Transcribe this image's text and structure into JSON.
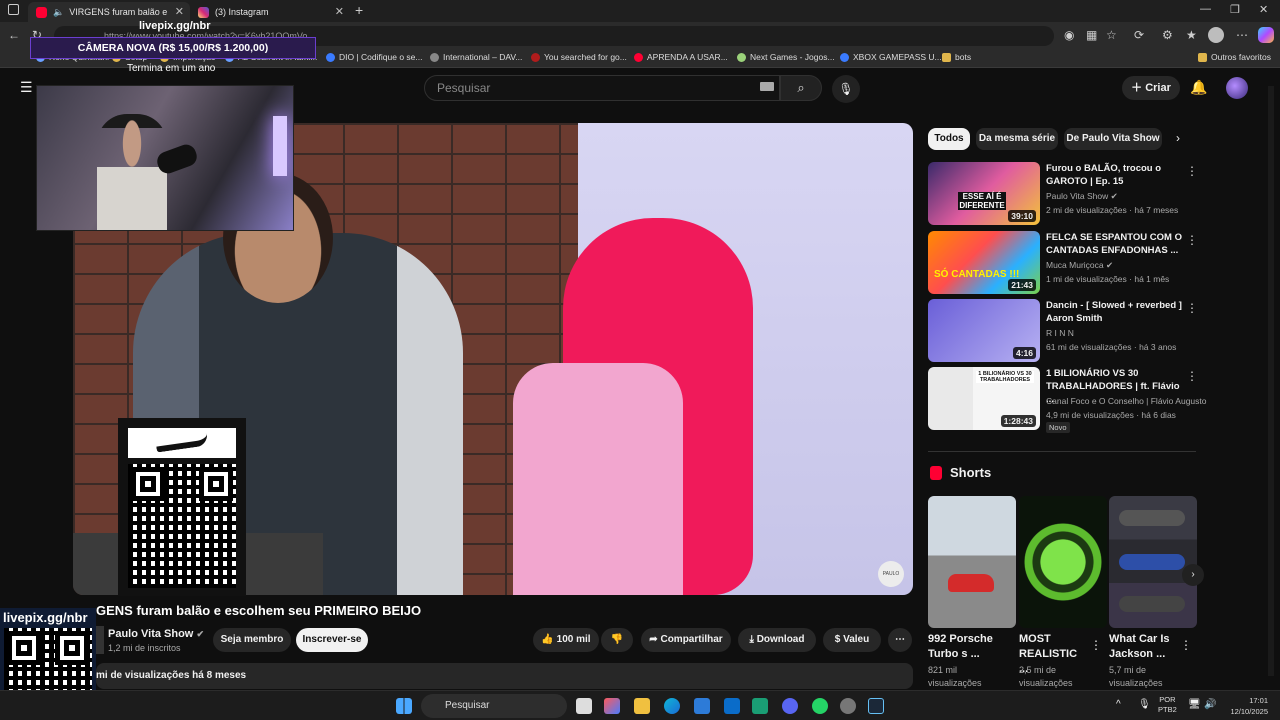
{
  "browser": {
    "tabs": [
      {
        "title": "VIRGENS furam balão e esco"
      },
      {
        "title": "(3) Instagram"
      }
    ],
    "url": "https://www.youtube.com/watch?v=K6vb21OQmVo",
    "bookmarks": [
      "Rene Quintiliani",
      "Setup",
      "Importação",
      "Ab Seafront in fami...",
      "DIO | Codifique o se...",
      "International – DAV...",
      "You searched for go...",
      "APRENDA A USAR...",
      "Next Games - Jogos...",
      "XBOX GAMEPASS U...",
      "bots",
      "Outros favoritos"
    ]
  },
  "overlay": {
    "url": "livepix.gg/nbr",
    "banner": "CÂMERA NOVA (R$ 15,00/R$ 1.200,00)",
    "note": "Termina em um ano",
    "qr_label": "livepix.gg/nbr"
  },
  "youtube": {
    "search_placeholder": "Pesquisar",
    "create_label": "Criar",
    "video": {
      "title": "VIRGENS furam balão e escolhem seu PRIMEIRO BEIJO",
      "title_visible": "GENS furam balão e escolhem seu PRIMEIRO BEIJO",
      "channel": "Paulo Vita Show",
      "subscribers": "1,2 mi de inscritos",
      "join_label": "Seja membro",
      "subscribe_label": "Inscrever-se",
      "likes": "100 mil",
      "share_label": "Compartilhar",
      "download_label": "Download",
      "thanks_label": "Valeu",
      "views_summary": "mi de visualizações  há 8 meses",
      "watermark": "PAULO VITA SHOW"
    },
    "chips": [
      "Todos",
      "Da mesma série",
      "De Paulo Vita Show"
    ],
    "recommendations": [
      {
        "title": "Furou o BALÃO, trocou o GAROTO | Ep. 15",
        "channel": "Paulo Vita Show",
        "meta": "2 mi de visualizações · há 7 meses",
        "duration": "39:10",
        "thumb_text": "ESSE AÍ É DIFERENTE"
      },
      {
        "title": "FELCA SE ESPANTOU COM O CANTADAS ENFADONHAS ...",
        "channel": "Muca Muriçoca",
        "meta": "1 mi de visualizações · há 1 mês",
        "duration": "21:43",
        "thumb_text": "SÓ CANTADAS !!!"
      },
      {
        "title": "Dancin - [ Slowed + reverbed ] Aaron Smith",
        "channel": "R I N N",
        "meta": "61 mi de visualizações · há 3 anos",
        "duration": "4:16",
        "thumb_text": ""
      },
      {
        "title": "1 BILIONÁRIO VS 30 TRABALHADORES | ft. Flávio ...",
        "channel": "Canal Foco e O Conselho | Flávio Augusto",
        "meta": "4,9 mi de visualizações · há 6 dias",
        "duration": "1:28:43",
        "thumb_text": "1 BILIONÁRIO VS 30 TRABALHADORES",
        "badge": "Novo"
      }
    ],
    "shorts_header": "Shorts",
    "shorts": [
      {
        "title": "992 Porsche Turbo s ...",
        "views": "821 mil visualizações"
      },
      {
        "title": "MOST REALISTIC ...",
        "views": "2,5 mi de visualizações"
      },
      {
        "title": "What Car Is Jackson ...",
        "views": "5,7 mi de visualizações"
      }
    ]
  },
  "taskbar": {
    "search_placeholder": "Pesquisar",
    "lang_line1": "POR",
    "lang_line2": "PTB2",
    "time": "17:01",
    "date": "12/10/2025"
  }
}
